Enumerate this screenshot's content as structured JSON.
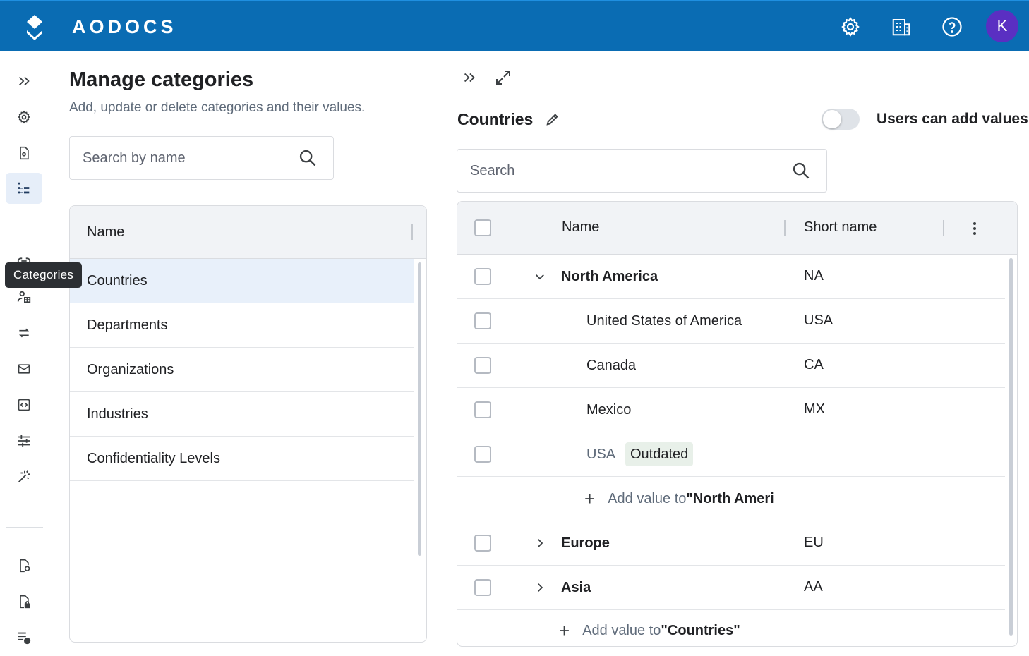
{
  "app": {
    "brand": "AODOCS",
    "avatar_initial": "K"
  },
  "topbar": {
    "icons": [
      "gear-icon",
      "building-icon",
      "help-icon"
    ]
  },
  "rail": {
    "tooltip": "Categories",
    "items": [
      "expand-icon",
      "settings-icon",
      "document-settings-icon",
      "categories-icon",
      "link-icon",
      "users-icon",
      "swap-icon",
      "mail-icon",
      "code-icon",
      "sliders-icon",
      "magic-wand-icon",
      "document-sync-icon",
      "document-lock-icon",
      "list-clock-icon"
    ]
  },
  "middle": {
    "title": "Manage categories",
    "subtitle": "Add, update or delete categories and their values.",
    "search_placeholder": "Search by name",
    "table_header": "Name",
    "categories": [
      "Countries",
      "Departments",
      "Organizations",
      "Industries",
      "Confidentiality Levels"
    ],
    "selected": "Countries"
  },
  "right": {
    "title": "Countries",
    "toggle_label": "Users can add values",
    "toggle_on": false,
    "search_placeholder": "Search",
    "col_name": "Name",
    "col_short": "Short name",
    "rows": {
      "r0": {
        "name": "North America",
        "short": "NA"
      },
      "r1": {
        "name": "United States of America",
        "short": "USA"
      },
      "r2": {
        "name": "Canada",
        "short": "CA"
      },
      "r3": {
        "name": "Mexico",
        "short": "MX"
      },
      "r4": {
        "name": "USA",
        "badge": "Outdated"
      },
      "r6": {
        "name": "Europe",
        "short": "EU"
      },
      "r7": {
        "name": "Asia",
        "short": "AA"
      }
    },
    "add_north_prefix": "Add value to ",
    "add_north_target": "\"North Ameri",
    "add_countries_prefix": "Add value to ",
    "add_countries_target": "\"Countries\""
  },
  "colors": {
    "topbar": "#0a6cb3",
    "selected_row": "#e8f0fa",
    "avatar": "#5a2fc2"
  }
}
